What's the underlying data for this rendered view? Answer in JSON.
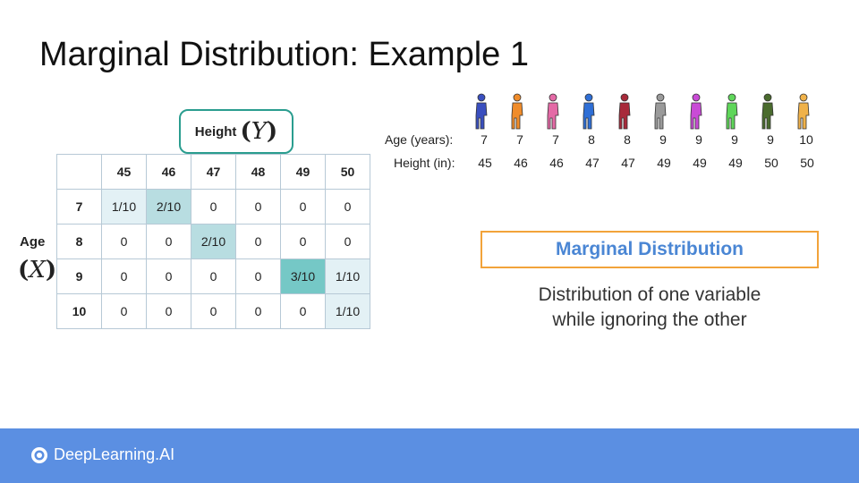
{
  "title": "Marginal Distribution: Example 1",
  "height_box": {
    "label": "Height",
    "symbol": "Y",
    "open": "(",
    "close": ")"
  },
  "age_box": {
    "label": "Age",
    "symbol": "X",
    "open": "(",
    "close": ")"
  },
  "table": {
    "height_values": [
      "45",
      "46",
      "47",
      "48",
      "49",
      "50"
    ],
    "rows": [
      {
        "age": "7",
        "cells": [
          "1/10",
          "2/10",
          "0",
          "0",
          "0",
          "0"
        ]
      },
      {
        "age": "8",
        "cells": [
          "0",
          "0",
          "2/10",
          "0",
          "0",
          "0"
        ]
      },
      {
        "age": "9",
        "cells": [
          "0",
          "0",
          "0",
          "0",
          "3/10",
          "1/10"
        ]
      },
      {
        "age": "10",
        "cells": [
          "0",
          "0",
          "0",
          "0",
          "0",
          "1/10"
        ]
      }
    ]
  },
  "people_colors": [
    "#3a4fbf",
    "#f08c2a",
    "#e46aa6",
    "#2f6fd6",
    "#a82a3a",
    "#9a9a9a",
    "#c94bd6",
    "#5fd65a",
    "#4a6b2e",
    "#f0b24a"
  ],
  "age_row": {
    "label": "Age (years):",
    "values": [
      "7",
      "7",
      "7",
      "8",
      "8",
      "9",
      "9",
      "9",
      "9",
      "10"
    ]
  },
  "height_row": {
    "label": "Height (in):",
    "values": [
      "45",
      "46",
      "46",
      "47",
      "47",
      "49",
      "49",
      "49",
      "50",
      "50"
    ]
  },
  "marginal": {
    "heading": "Marginal Distribution",
    "desc_line1": "Distribution of one variable",
    "desc_line2": "while ignoring the other"
  },
  "footer": {
    "brand": "DeepLearning.AI"
  },
  "colors": {
    "teal": "#2a9d8f",
    "orange": "#f2a33a",
    "green": "#a8c83a",
    "blue": "#4a86d4",
    "footer_bg": "#5b8fe2"
  }
}
